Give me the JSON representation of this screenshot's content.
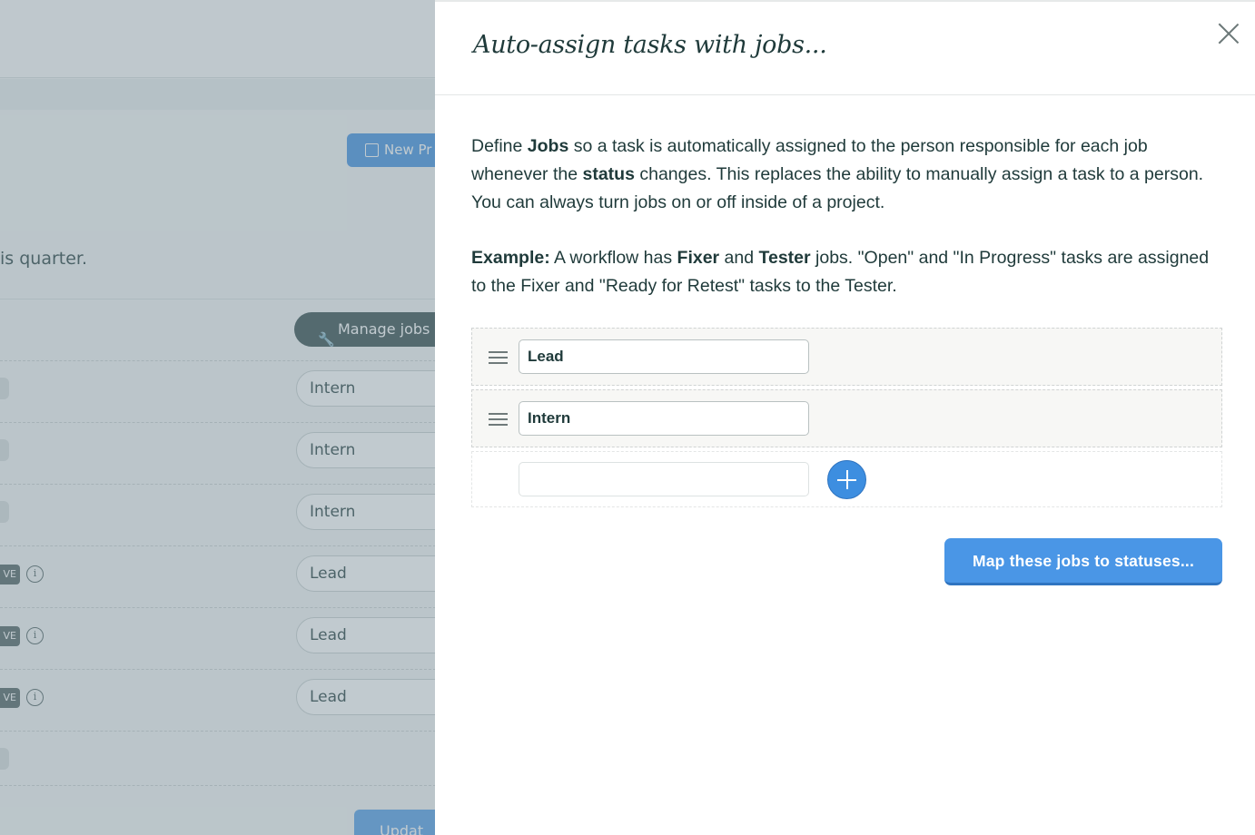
{
  "background": {
    "new_button_label": "New Pr",
    "quarter_text": "is quarter.",
    "manage_jobs_label": "Manage jobs",
    "rows": [
      {
        "tag": "",
        "info": false,
        "job": "Intern"
      },
      {
        "tag": "",
        "info": false,
        "job": "Intern"
      },
      {
        "tag": "",
        "info": false,
        "job": "Intern"
      },
      {
        "tag": "VE",
        "info": true,
        "job": "Lead"
      },
      {
        "tag": "VE",
        "info": true,
        "job": "Lead"
      },
      {
        "tag": "VE",
        "info": true,
        "job": "Lead"
      }
    ],
    "info_glyph": "i",
    "update_button_label": "Updat"
  },
  "modal": {
    "title": "Auto-assign tasks with jobs...",
    "para1": {
      "t1": "Define ",
      "b1": "Jobs",
      "t2": " so a task is automatically assigned to the person responsible for each job whenever the ",
      "b2": "status",
      "t3": " changes. This replaces the ability to manually assign a task to a person. You can always turn jobs on or off inside of a project."
    },
    "para2": {
      "b1": "Example:",
      "t1": " A workflow has ",
      "b2": "Fixer",
      "t2": " and ",
      "b3": "Tester",
      "t3": " jobs. \"Open\" and \"In Progress\" tasks are assigned to the Fixer and \"Ready for Retest\" tasks to the Tester."
    },
    "jobs": [
      {
        "value": "Lead"
      },
      {
        "value": "Intern"
      }
    ],
    "new_job_value": "",
    "map_button_label": "Map these jobs to statuses..."
  }
}
